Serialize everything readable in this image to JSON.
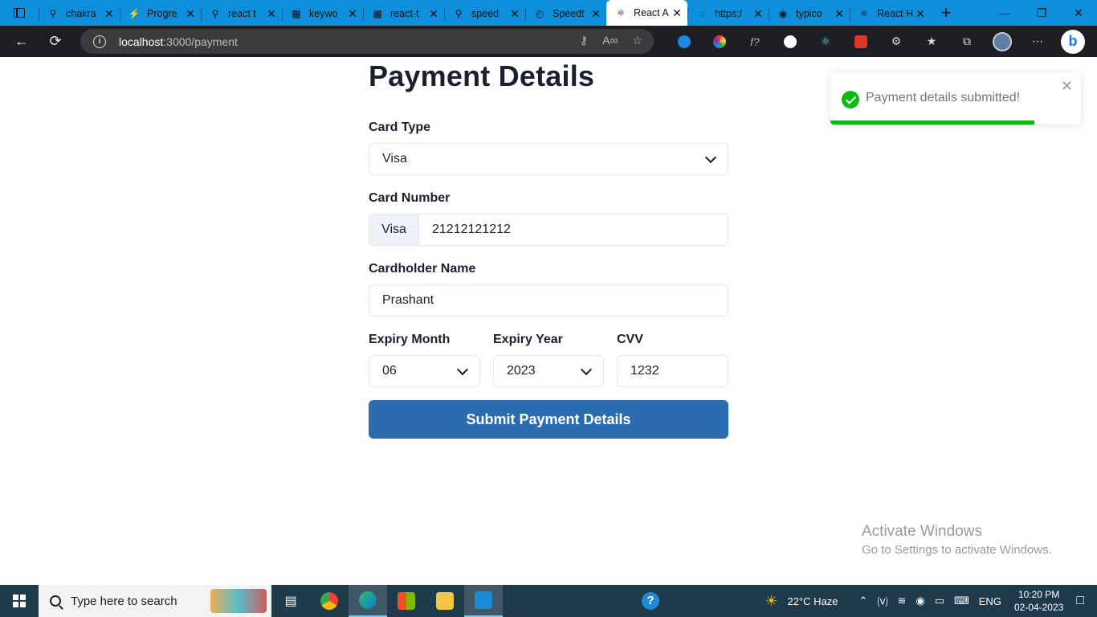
{
  "browser": {
    "tabs": [
      {
        "title": "chakra",
        "icon": "search-icon"
      },
      {
        "title": "Progre",
        "icon": "lightning-icon"
      },
      {
        "title": "react t",
        "icon": "search-icon"
      },
      {
        "title": "keywo",
        "icon": "bookmark-app-icon"
      },
      {
        "title": "react-t",
        "icon": "bookmark-app-icon"
      },
      {
        "title": "speed",
        "icon": "search-icon"
      },
      {
        "title": "Speedt",
        "icon": "speedtest-icon"
      },
      {
        "title": "React A",
        "icon": "react-icon",
        "active": true
      },
      {
        "title": "https:/",
        "icon": "loading-icon"
      },
      {
        "title": "typico",
        "icon": "github-icon"
      },
      {
        "title": "React H",
        "icon": "react-icon"
      }
    ],
    "url_host": "localhost",
    "url_path": ":3000/payment"
  },
  "page": {
    "title": "Payment Details",
    "card_type_label": "Card Type",
    "card_type_value": "Visa",
    "card_number_label": "Card Number",
    "card_number_addon": "Visa",
    "card_number_value": "21212121212",
    "cardholder_label": "Cardholder Name",
    "cardholder_value": "Prashant",
    "expiry_month_label": "Expiry Month",
    "expiry_month_value": "06",
    "expiry_year_label": "Expiry Year",
    "expiry_year_value": "2023",
    "cvv_label": "CVV",
    "cvv_value": "1232",
    "submit_label": "Submit Payment Details"
  },
  "toast": {
    "message": "Payment details submitted!",
    "progress_fraction": 0.815,
    "color": "#07bc0c"
  },
  "watermark": {
    "title": "Activate Windows",
    "subtitle": "Go to Settings to activate Windows."
  },
  "taskbar": {
    "search_placeholder": "Type here to search",
    "weather": "22°C  Haze",
    "language": "ENG",
    "time": "10:20 PM",
    "date": "02-04-2023"
  },
  "colors": {
    "accent": "#2b6cb0",
    "tabstrip": "#0e8fdc",
    "toolbar": "#1e1f22"
  }
}
